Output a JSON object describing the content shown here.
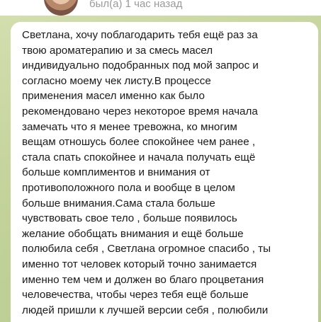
{
  "header": {
    "status": "был(а) 1 час назад"
  },
  "message": {
    "text": "Светлана, хочу поблагодарить тебя ещё раз  за\nтвою ароматерапию и за смесь масел\nиндивидуально подобранных под мой запрос и\nсогласно моему чек листу.В процессе\nприменения масел именно как было\nрекомендовано через некоторое время начала\nзамечать что я менее тревожна, ко многим\nвещам отношусь более спокойнее чем ранее ,\nстала спать спокойнее и начала получать ещё\nбольше комплиментов и внимания от\nпротивоположного пола и вообще в целом\nбольше внимания.Сама стала больше\nчувствовать свое тело , больше появилось\nжелание обобщать внимания и ещё больше\nполюбила себя , Светлана огромное спасибо , ты\nименно тот человек который точно занимается\nименно тем чем и должен во благо процветания\nчеловечества, чтобы через тебя ещё больше\nлюдей пришли к лучшей версии себя , полюбили"
  }
}
